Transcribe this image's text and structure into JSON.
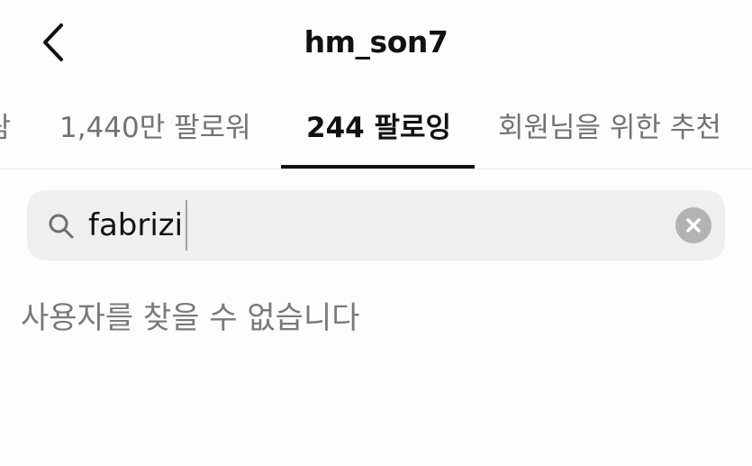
{
  "header": {
    "title": "hm_son7",
    "back_icon": "chevron-left-icon"
  },
  "tabs": [
    {
      "label": "람",
      "active": false
    },
    {
      "label": "1,440만 팔로워",
      "active": false
    },
    {
      "label": "244 팔로잉",
      "active": true
    },
    {
      "label": "회원님을 위한 추천",
      "active": false
    }
  ],
  "search": {
    "value": "fabrizi",
    "placeholder": "",
    "search_icon": "search-icon",
    "clear_icon": "clear-icon"
  },
  "results": {
    "empty_message": "사용자를 찾을 수 없습니다"
  },
  "colors": {
    "background": "#fdfdfd",
    "text_primary": "#111111",
    "text_secondary": "#737373",
    "search_bg": "#efefef",
    "clear_button": "#b3b3b3"
  }
}
